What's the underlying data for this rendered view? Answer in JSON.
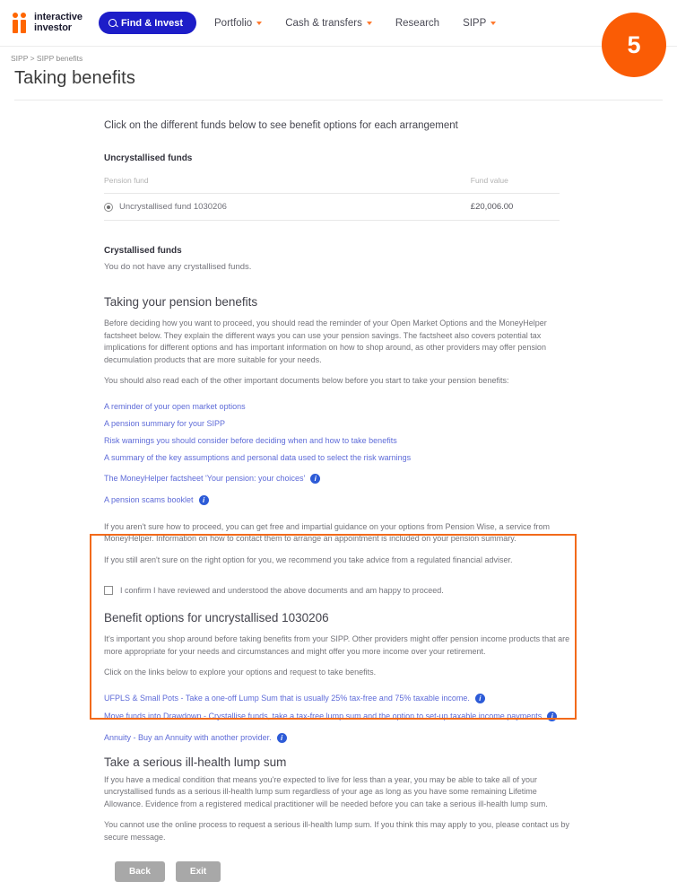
{
  "header": {
    "logo_line1": "interactive",
    "logo_line2": "investor",
    "find_invest_label": "Find & Invest",
    "nav": [
      {
        "label": "Portfolio",
        "has_chevron": true
      },
      {
        "label": "Cash & transfers",
        "has_chevron": true
      },
      {
        "label": "Research",
        "has_chevron": false
      },
      {
        "label": "SIPP",
        "has_chevron": true
      }
    ],
    "badge": "5"
  },
  "breadcrumb": "SIPP > SIPP benefits",
  "page_title": "Taking benefits",
  "main": {
    "lead": "Click on the different funds below to see benefit options for each arrangement",
    "uncrystallised_label": "Uncrystallised funds",
    "table": {
      "headers": [
        "Pension fund",
        "Fund value"
      ],
      "rows": [
        {
          "fund": "Uncrystallised fund 1030206",
          "value": "£20,006.00",
          "selected": true
        }
      ]
    },
    "crystallised_label": "Crystallised funds",
    "crystallised_text": "You do not have any crystallised funds.",
    "section_heading": "Taking your pension benefits",
    "paragraphs": [
      "Before deciding how you want to proceed, you should read the reminder of your Open Market Options and the MoneyHelper factsheet below. They explain the different ways you can use your pension savings. The factsheet also covers potential tax implications for different options and has important information on how to shop around, as other providers may offer pension decumulation products that are more suitable for your needs.",
      "You should also read each of the other important documents below before you start to take your pension benefits:"
    ],
    "document_links": [
      {
        "text": "A reminder of your open market options",
        "info": false
      },
      {
        "text": "A pension summary for your SIPP",
        "info": false
      },
      {
        "text": "Risk warnings you should consider before deciding when and how to take benefits",
        "info": false
      },
      {
        "text": "A summary of the key assumptions and personal data used to select the risk warnings",
        "info": false
      },
      {
        "text": "The MoneyHelper factsheet 'Your pension: your choices'",
        "info": true
      },
      {
        "text": "A pension scams booklet",
        "info": true
      }
    ],
    "guidance_paragraphs": [
      "If you aren't sure how to proceed, you can get free and impartial guidance on your options from Pension Wise, a service from MoneyHelper. Information on how to contact them to arrange an appointment is included on your pension summary.",
      "If you still aren't sure on the right option for you, we recommend you take advice from a regulated financial adviser."
    ],
    "confirm_checkbox": {
      "label": "I confirm I have reviewed and understood the above documents and am happy to proceed.",
      "checked": false
    },
    "benefit_options": {
      "heading": "Benefit options for uncrystallised 1030206",
      "paragraphs": [
        "It's important you shop around before taking benefits from your SIPP. Other providers might offer pension income products that are more appropriate for your needs and circumstances and might offer you more income over your retirement.",
        "Click on the links below to explore your options and request to take benefits."
      ],
      "links": [
        {
          "text": "UFPLS & Small Pots - Take a one-off Lump Sum that is usually 25% tax-free and 75% taxable income.",
          "info": true
        },
        {
          "text": "Move funds into Drawdown - Crystallise funds, take a tax-free lump sum and the option to set-up taxable income payments",
          "info": true
        },
        {
          "text": "Annuity - Buy an Annuity with another provider.",
          "info": true
        }
      ]
    },
    "ill_health": {
      "heading": "Take a serious ill-health lump sum",
      "paragraphs": [
        "If you have a medical condition that means you're expected to live for less than a year, you may be able to take all of your uncrystallised funds as a serious ill-health lump sum regardless of your age as long as you have some remaining Lifetime Allowance. Evidence from a registered medical practitioner will be needed before you can take a serious ill-health lump sum.",
        "You cannot use the online process to request a serious ill-health lump sum. If you think this may apply to you, please contact us by secure message."
      ]
    },
    "buttons": {
      "back": "Back",
      "exit": "Exit"
    }
  },
  "colors": {
    "brand_orange": "#FF6600",
    "highlight_orange": "#F26A1B",
    "link_blue": "#5E6BD8",
    "find_invest_blue": "#1D1DC8"
  }
}
